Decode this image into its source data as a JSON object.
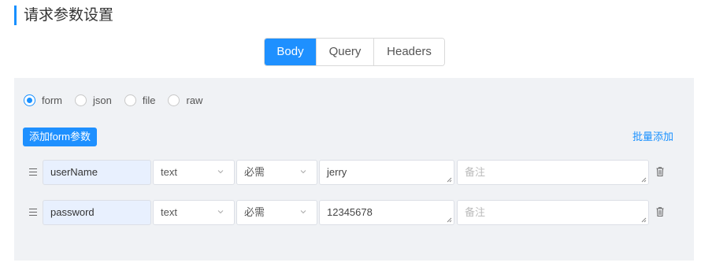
{
  "section": {
    "title": "请求参数设置"
  },
  "tabs": [
    {
      "label": "Body",
      "active": true
    },
    {
      "label": "Query",
      "active": false
    },
    {
      "label": "Headers",
      "active": false
    }
  ],
  "body_types": [
    {
      "label": "form",
      "checked": true
    },
    {
      "label": "json",
      "checked": false
    },
    {
      "label": "file",
      "checked": false
    },
    {
      "label": "raw",
      "checked": false
    }
  ],
  "add_button_label": "添加form参数",
  "bulk_add_label": "批量添加",
  "params": [
    {
      "name": "userName",
      "type": "text",
      "required": "必需",
      "value": "jerry",
      "note_placeholder": "备注"
    },
    {
      "name": "password",
      "type": "text",
      "required": "必需",
      "value": "12345678",
      "note_placeholder": "备注"
    }
  ],
  "colors": {
    "accent": "#1e90ff",
    "panel_bg": "#f0f2f5",
    "name_field_bg": "#e8f0fe"
  },
  "icons": {
    "drag": "list-drag-icon",
    "trash": "trash-icon",
    "chevron": "chevron-down-icon"
  }
}
